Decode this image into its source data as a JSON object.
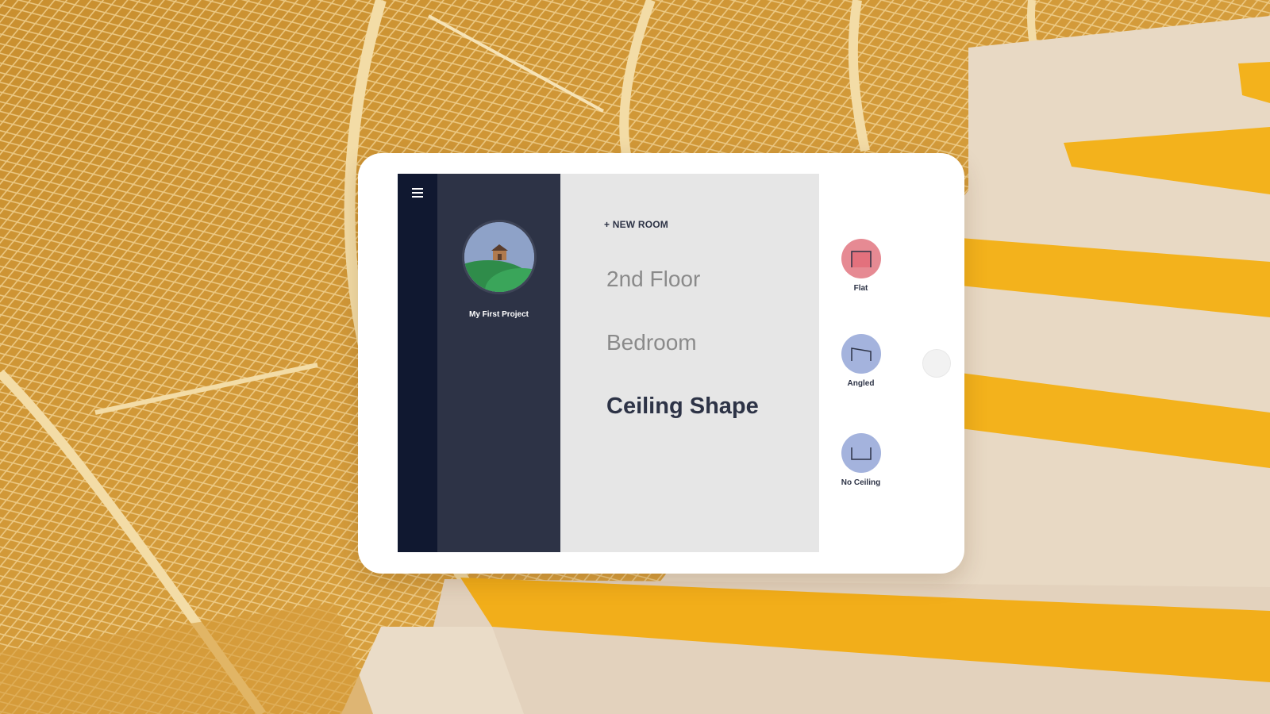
{
  "sidebar": {
    "project_name": "My First Project"
  },
  "main": {
    "new_room_label": "+ NEW ROOM",
    "breadcrumbs": [
      "2nd Floor",
      "Bedroom"
    ],
    "current_step": "Ceiling Shape"
  },
  "ceiling_options": [
    {
      "label": "Flat",
      "icon": "flat-ceiling-icon",
      "color": "#e68a93"
    },
    {
      "label": "Angled",
      "icon": "angled-ceiling-icon",
      "color": "#a4b3dd"
    },
    {
      "label": "No Ceiling",
      "icon": "no-ceiling-icon",
      "color": "#a4b3dd"
    }
  ],
  "colors": {
    "rail": "#101830",
    "sidebar": "#2d3346",
    "main_bg": "#e6e6e6",
    "accent_selected": "#e68a93",
    "accent_option": "#a4b3dd"
  }
}
